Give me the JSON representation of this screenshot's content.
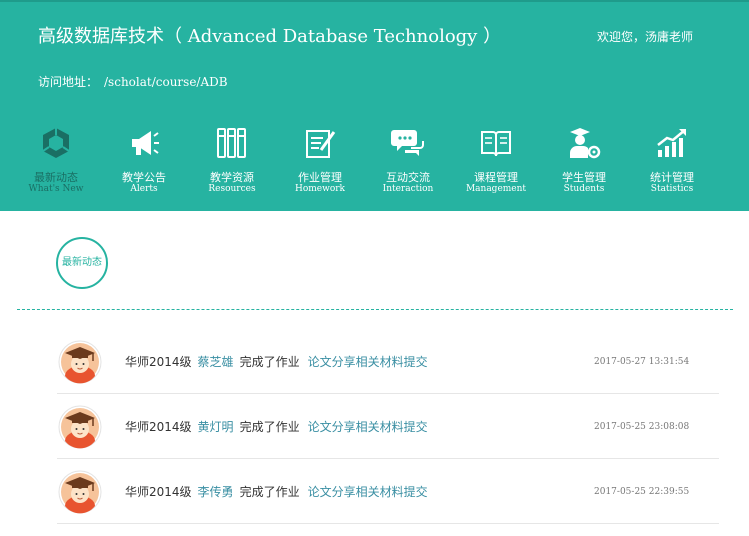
{
  "header": {
    "course_title": "高级数据库技术（ Advanced Database Technology ）",
    "welcome": "欢迎您，汤庸老师",
    "address_label": "访问地址：",
    "address_value": "/scholat/course/ADB"
  },
  "nav": {
    "items": [
      {
        "cn": "最新动态",
        "en": "What's New",
        "icon": "cube-icon",
        "active": true
      },
      {
        "cn": "教学公告",
        "en": "Alerts",
        "icon": "megaphone-icon",
        "active": false
      },
      {
        "cn": "教学资源",
        "en": "Resources",
        "icon": "books-icon",
        "active": false
      },
      {
        "cn": "作业管理",
        "en": "Homework",
        "icon": "document-edit-icon",
        "active": false
      },
      {
        "cn": "互动交流",
        "en": "Interaction",
        "icon": "chat-bubbles-icon",
        "active": false
      },
      {
        "cn": "课程管理",
        "en": "Management",
        "icon": "open-book-icon",
        "active": false
      },
      {
        "cn": "学生管理",
        "en": "Students",
        "icon": "student-gear-icon",
        "active": false
      },
      {
        "cn": "统计管理",
        "en": "Statistics",
        "icon": "bar-chart-icon",
        "active": false
      }
    ]
  },
  "section": {
    "badge": "最新动态"
  },
  "feed": [
    {
      "class_name": "华师2014级",
      "student": "蔡芝雄",
      "action": "完成了作业",
      "assignment": "论文分享相关材料提交",
      "time": "2017-05-27 13:31:54",
      "avatar": "graduate-avatar-icon"
    },
    {
      "class_name": "华师2014级",
      "student": "黄灯明",
      "action": "完成了作业",
      "assignment": "论文分享相关材料提交",
      "time": "2017-05-25 23:08:08",
      "avatar": "graduate-avatar-icon"
    },
    {
      "class_name": "华师2014级",
      "student": "李传勇",
      "action": "完成了作业",
      "assignment": "论文分享相关材料提交",
      "time": "2017-05-25 22:39:55",
      "avatar": "graduate-avatar-icon"
    }
  ],
  "colors": {
    "primary": "#26b3a1",
    "active_nav": "#1a6f64",
    "link": "#3a8fa3"
  }
}
